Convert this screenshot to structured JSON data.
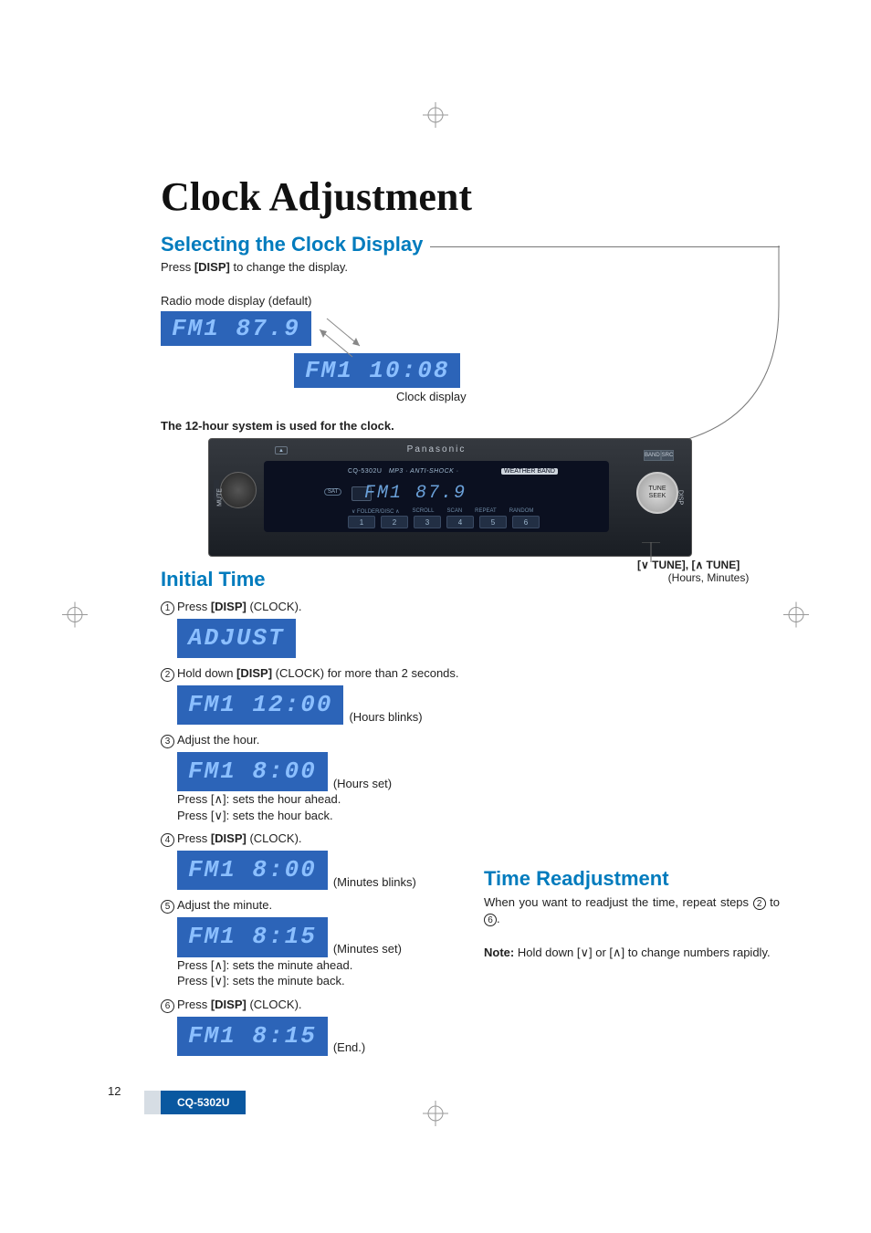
{
  "page_number": "12",
  "model_badge": "CQ-5302U",
  "title": "Clock Adjustment",
  "selecting": {
    "heading": "Selecting the Clock Display",
    "press_line_pre": "Press ",
    "press_line_btn": "[DISP]",
    "press_line_post": " to change the display.",
    "radio_mode_label": "Radio mode display (default)",
    "lcd_radio": "FM1   87.9",
    "lcd_clock": "FM1  10:08",
    "clock_display_label": "Clock display",
    "system_note": "The 12-hour system is used for the clock."
  },
  "radio": {
    "brand": "Panasonic",
    "model": "CQ-5302U",
    "tagline": "MP3 · ANTI-SHOCK ·",
    "weather_band": "WEATHER BAND",
    "display": "FM1   87.9",
    "sat": "SAT",
    "mute": "MUTE",
    "disp": "DISP",
    "eject": "▲",
    "band": "BAND",
    "src": "SRC",
    "tune_seek": "TUNE\nSEEK",
    "btn_top_labels": [
      "∨ FOLDER/DISC ∧",
      "SCROLL",
      "SCAN",
      "REPEAT",
      "RANDOM"
    ],
    "buttons": [
      "1",
      "2",
      "3",
      "4",
      "5",
      "6"
    ]
  },
  "tune_callout": {
    "line": "[∨ TUNE], [∧ TUNE]",
    "sub": "(Hours, Minutes)"
  },
  "initial": {
    "heading": "Initial Time",
    "steps": [
      {
        "n": "1",
        "pre": "Press ",
        "bold": "[DISP]",
        "post": " (CLOCK).",
        "lcd": "ADJUST",
        "aside": "",
        "up": "",
        "down": ""
      },
      {
        "n": "2",
        "pre": "Hold down ",
        "bold": "[DISP]",
        "post": " (CLOCK) for more than 2 seconds.",
        "lcd": "FM1   12:00",
        "aside": "(Hours blinks)",
        "up": "",
        "down": ""
      },
      {
        "n": "3",
        "pre": "Adjust the hour.",
        "bold": "",
        "post": "",
        "lcd": "FM1    8:00",
        "aside": "(Hours set)",
        "up": "Press [∧]: sets the hour ahead.",
        "down": "Press [∨]: sets the hour back."
      },
      {
        "n": "4",
        "pre": "Press ",
        "bold": "[DISP]",
        "post": " (CLOCK).",
        "lcd": "FM1    8:00",
        "aside": "(Minutes blinks)",
        "up": "",
        "down": ""
      },
      {
        "n": "5",
        "pre": "Adjust the minute.",
        "bold": "",
        "post": "",
        "lcd": "FM1    8:15",
        "aside": "(Minutes set)",
        "up": "Press [∧]: sets the minute ahead.",
        "down": "Press [∨]: sets the minute back."
      },
      {
        "n": "6",
        "pre": "Press ",
        "bold": "[DISP]",
        "post": " (CLOCK).",
        "lcd": "FM1    8:15",
        "aside": "(End.)",
        "up": "",
        "down": ""
      }
    ]
  },
  "readjust": {
    "heading": "Time Readjustment",
    "body_pre": "When you want to readjust the time, repeat steps ",
    "body_s1": "2",
    "body_mid": " to ",
    "body_s2": "6",
    "body_post": ".",
    "note_pre": "Note:",
    "note_body": " Hold down [∨] or [∧] to change numbers rapidly."
  }
}
